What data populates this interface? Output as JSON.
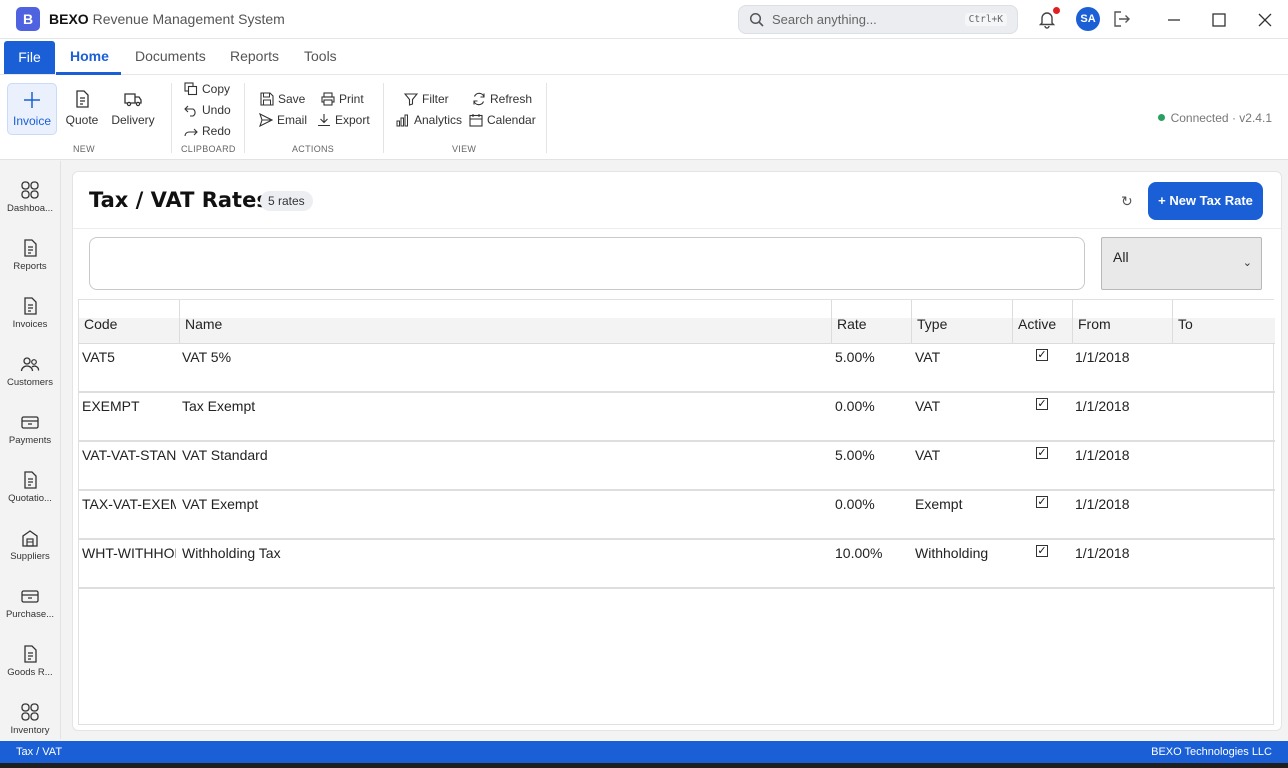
{
  "app": {
    "logo_letter": "B",
    "brand": "BEXO",
    "subtitle": "Revenue Management System"
  },
  "search": {
    "placeholder": "Search anything...",
    "shortcut": "Ctrl+K"
  },
  "user": {
    "initials": "SA"
  },
  "menu": {
    "file": "File",
    "tabs": [
      "Home",
      "Documents",
      "Reports",
      "Tools"
    ],
    "active_tab": "Home"
  },
  "ribbon": {
    "new": {
      "label": "NEW",
      "buttons": [
        "Invoice",
        "Quote",
        "Delivery"
      ]
    },
    "clipboard": {
      "label": "CLIPBOARD",
      "buttons": [
        "Copy",
        "Undo",
        "Redo"
      ]
    },
    "actions": {
      "label": "ACTIONS",
      "buttons": [
        "Save",
        "Print",
        "Email",
        "Export"
      ]
    },
    "view": {
      "label": "VIEW",
      "buttons": [
        "Filter",
        "Refresh",
        "Analytics",
        "Calendar"
      ]
    },
    "status": {
      "connection": "Connected",
      "separator": "·",
      "version": "v2.4.1"
    }
  },
  "sidebar": {
    "items": [
      "Dashboa...",
      "Reports",
      "Invoices",
      "Customers",
      "Payments",
      "Quotatio...",
      "Suppliers",
      "Purchase...",
      "Goods R...",
      "Inventory"
    ]
  },
  "page": {
    "title": "Tax / VAT Rates",
    "count_badge": "5 rates",
    "refresh_glyph": "↻",
    "new_button": "+  New Tax Rate",
    "filter": {
      "search_value": "",
      "select_value": "All"
    }
  },
  "table": {
    "columns": [
      "Code",
      "Name",
      "Rate",
      "Type",
      "Active",
      "From",
      "To"
    ],
    "rows": [
      {
        "code": "VAT5",
        "name": "VAT 5%",
        "rate": "5.00%",
        "type": "VAT",
        "active": true,
        "from": "1/1/2018",
        "to": ""
      },
      {
        "code": "EXEMPT",
        "name": "Tax Exempt",
        "rate": "0.00%",
        "type": "VAT",
        "active": true,
        "from": "1/1/2018",
        "to": ""
      },
      {
        "code": "VAT-VAT-STANI",
        "name": "VAT Standard",
        "rate": "5.00%",
        "type": "VAT",
        "active": true,
        "from": "1/1/2018",
        "to": ""
      },
      {
        "code": "TAX-VAT-EXEM",
        "name": "VAT Exempt",
        "rate": "0.00%",
        "type": "Exempt",
        "active": true,
        "from": "1/1/2018",
        "to": ""
      },
      {
        "code": "WHT-WITHHOL",
        "name": "Withholding Tax",
        "rate": "10.00%",
        "type": "Withholding",
        "active": true,
        "from": "1/1/2018",
        "to": ""
      }
    ]
  },
  "statusbar": {
    "left": "Tax / VAT",
    "right": "BEXO Technologies LLC"
  },
  "colors": {
    "accent": "#1a5fd6",
    "logo": "#4f63e0",
    "online": "#2aa060",
    "notification": "#e02020"
  }
}
